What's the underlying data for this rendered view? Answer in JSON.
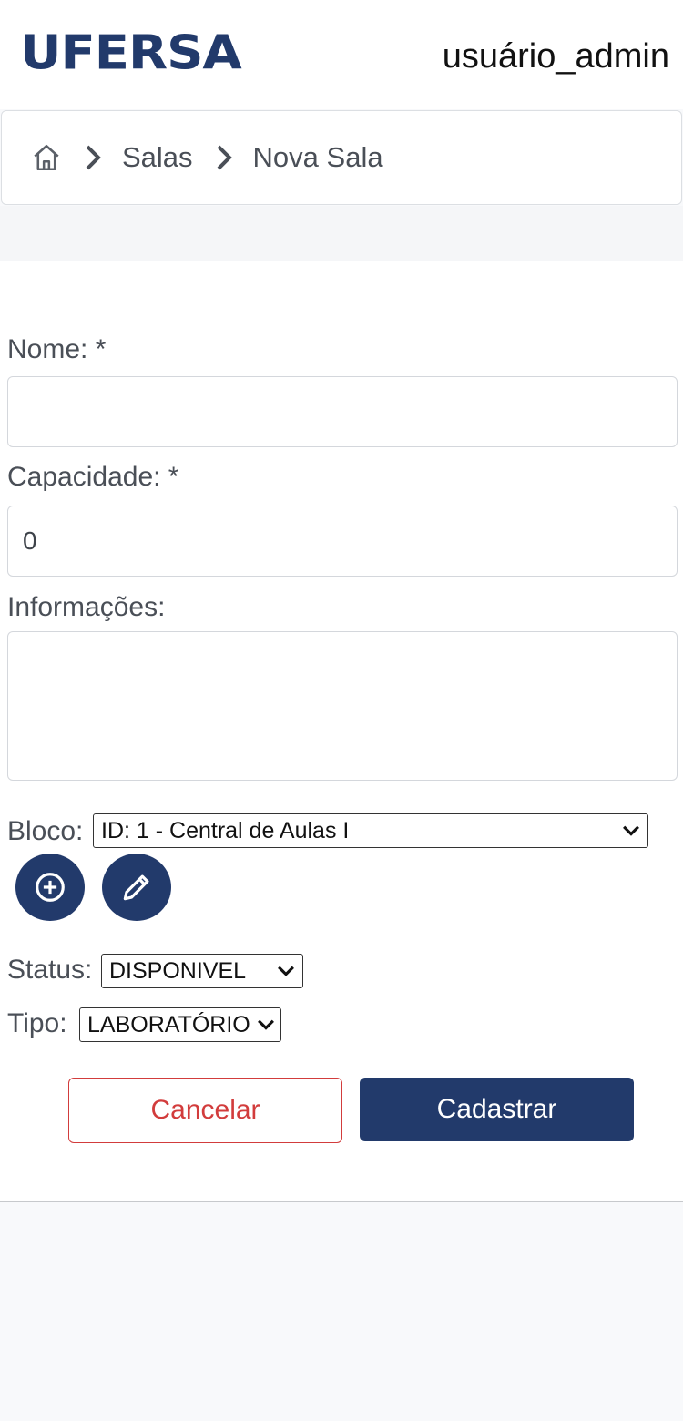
{
  "header": {
    "logo": "UFERSA",
    "username": "usuário_admin"
  },
  "breadcrumb": {
    "home_icon": "home-icon",
    "items": [
      "Salas",
      "Nova Sala"
    ]
  },
  "form": {
    "nome": {
      "label": "Nome: *",
      "value": ""
    },
    "capacidade": {
      "label": "Capacidade: *",
      "value": "0"
    },
    "informacoes": {
      "label": "Informações:",
      "value": ""
    },
    "bloco": {
      "label": "Bloco:",
      "selected": "ID: 1 - Central de Aulas I"
    },
    "status": {
      "label": "Status:",
      "selected": "DISPONIVEL"
    },
    "tipo": {
      "label": "Tipo:",
      "selected": "LABORATÓRIO"
    },
    "cancel_label": "Cancelar",
    "submit_label": "Cadastrar"
  },
  "colors": {
    "brand": "#223a6b",
    "danger": "#d23c3c",
    "background": "#f8f9fb"
  }
}
